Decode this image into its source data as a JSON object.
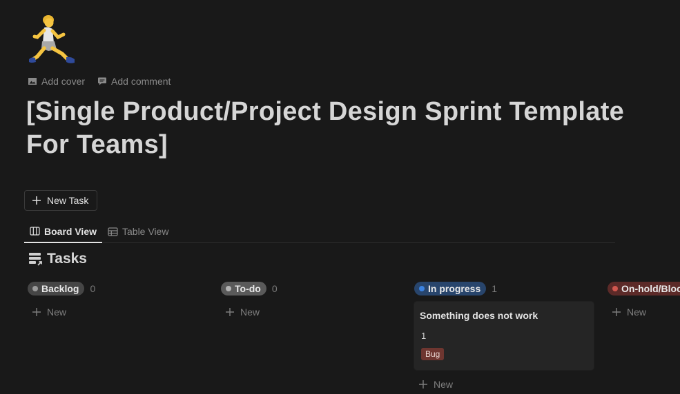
{
  "page": {
    "icon": "person-running-icon",
    "add_cover": "Add cover",
    "add_comment": "Add comment",
    "title": "[Single Product/Project Design Sprint Template For Teams]"
  },
  "toolbar": {
    "new_task_label": "New Task"
  },
  "views": [
    {
      "label": "Board View",
      "icon": "board-icon",
      "active": true
    },
    {
      "label": "Table View",
      "icon": "table-icon",
      "active": false
    }
  ],
  "database": {
    "title": "Tasks",
    "icon": "tasks-database-icon"
  },
  "board": {
    "new_label": "New",
    "columns": [
      {
        "status": "Backlog",
        "count": "0",
        "pill_color": "#464646",
        "dot_color": "#9b9b9b",
        "cards": []
      },
      {
        "status": "To-do",
        "count": "0",
        "pill_color": "#5a5a5a",
        "dot_color": "#b5b5b5",
        "cards": []
      },
      {
        "status": "In progress",
        "count": "1",
        "pill_color": "#28456c",
        "dot_color": "#3b82e0",
        "cards": [
          {
            "title": "Something does not work",
            "number": "1",
            "tag": "Bug",
            "tag_color": "#6e3630"
          }
        ]
      },
      {
        "status": "On-hold/Blocked",
        "count": "",
        "pill_color": "#5c2a28",
        "dot_color": "#d0574f",
        "cards": []
      }
    ]
  },
  "colors": {
    "background": "#191919",
    "card": "#252525",
    "text": "#d4d4d4",
    "muted": "#8a8a8a"
  }
}
